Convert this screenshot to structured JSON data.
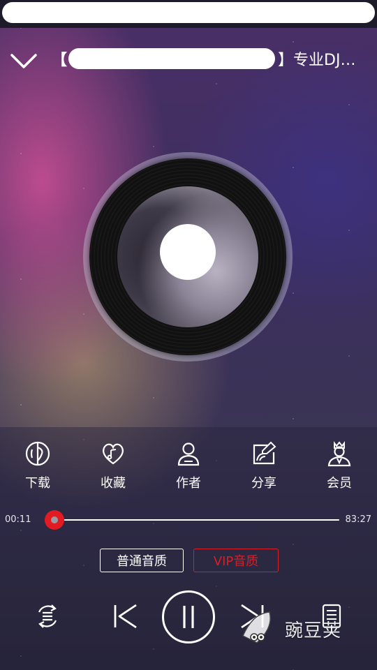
{
  "header": {
    "title_prefix": "【",
    "title_suffix": "】专业DJ…"
  },
  "actions": [
    {
      "label": "下载",
      "icon": "download-icon"
    },
    {
      "label": "收藏",
      "icon": "favorite-heart-icon"
    },
    {
      "label": "作者",
      "icon": "author-person-icon"
    },
    {
      "label": "分享",
      "icon": "share-icon"
    },
    {
      "label": "会员",
      "icon": "vip-crown-person-icon"
    }
  ],
  "progress": {
    "current_time": "00:11",
    "total_time": "83:27",
    "fraction": 0.002
  },
  "quality": {
    "normal_label": "普通音质",
    "vip_label": "VIP音质"
  },
  "controls": {
    "play_mode_icon": "playlist-loop-icon",
    "prev_icon": "previous-icon",
    "play_state_icon": "pause-icon",
    "next_icon": "next-icon",
    "playlist_icon": "playlist-icon"
  },
  "watermark": {
    "text": "豌豆荚"
  },
  "colors": {
    "accent_red": "#e21b23",
    "vip_red": "#d91f26",
    "panel": "rgba(40,36,60,0.45)"
  }
}
